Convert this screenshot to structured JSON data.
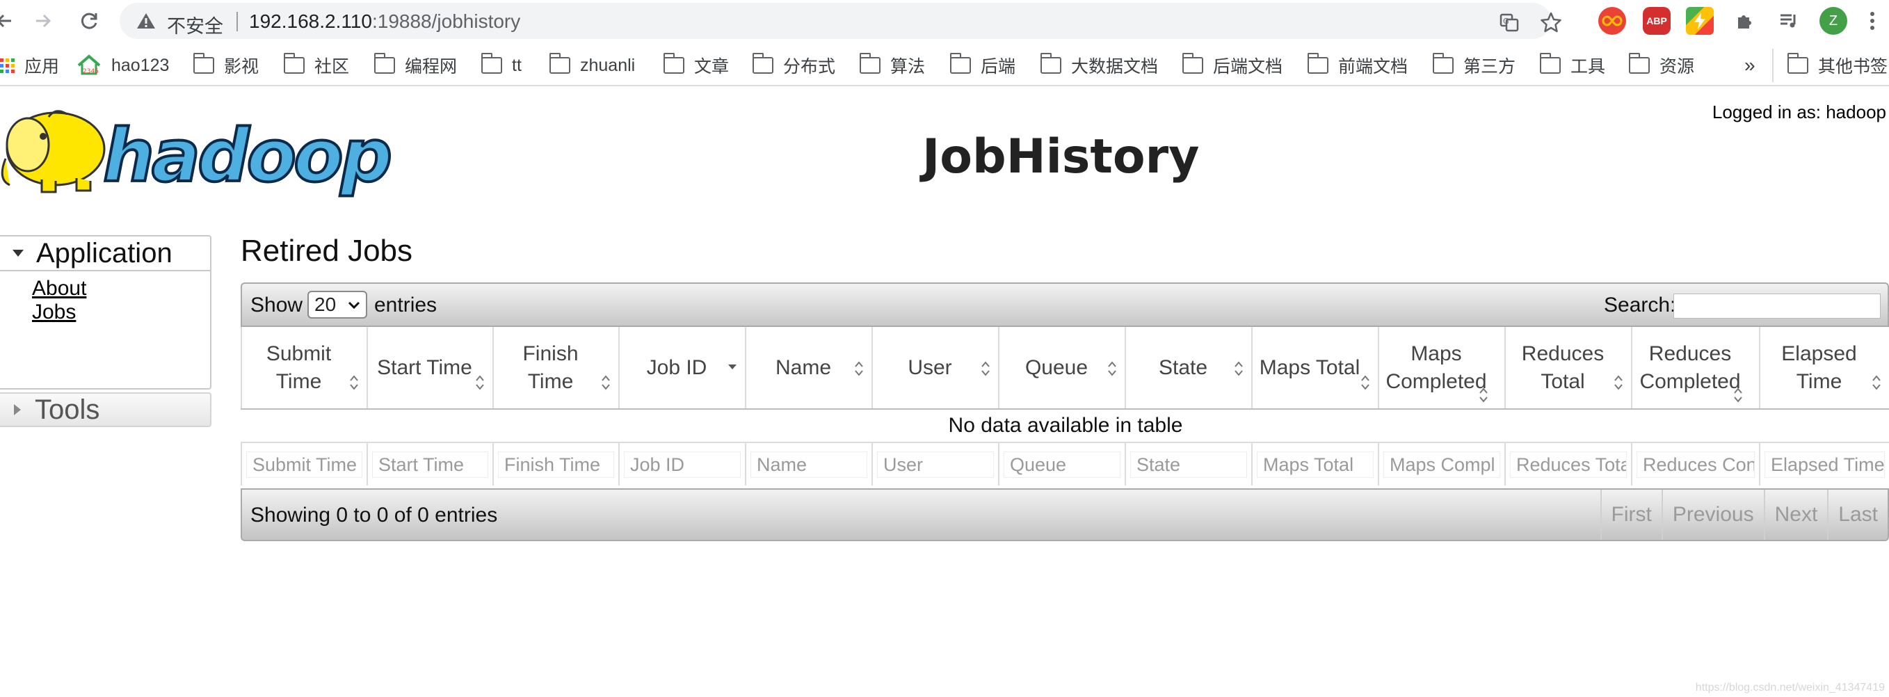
{
  "browser": {
    "security_label": "不安全",
    "url_host": "192.168.2.110",
    "url_rest": ":19888/jobhistory",
    "profile_initial": "Z",
    "ext_abp": "ABP"
  },
  "bookmarks": {
    "items": [
      "应用",
      "hao123",
      "影视",
      "社区",
      "编程网",
      "tt",
      "zhuanli",
      "文章",
      "分布式",
      "算法",
      "后端",
      "大数据文档",
      "后端文档",
      "前端文档",
      "第三方",
      "工具",
      "资源"
    ],
    "more": "»",
    "other": "其他书签"
  },
  "page": {
    "logged_in": "Logged in as: hadoop",
    "logo_text": "hadoop",
    "title": "JobHistory"
  },
  "nav": {
    "application": "Application",
    "links": [
      "About",
      "Jobs"
    ],
    "tools": "Tools"
  },
  "main": {
    "section_title": "Retired Jobs",
    "show_label": "Show",
    "page_length": "20",
    "entries_label": "entries",
    "search_label": "Search:",
    "columns": [
      "Submit Time",
      "Start Time",
      "Finish Time",
      "Job ID",
      "Name",
      "User",
      "Queue",
      "State",
      "Maps Total",
      "Maps Completed",
      "Reduces Total",
      "Reduces Completed",
      "Elapsed Time"
    ],
    "empty_message": "No data available in table",
    "filter_placeholders": [
      "Submit Time",
      "Start Time",
      "Finish Time",
      "Job ID",
      "Name",
      "User",
      "Queue",
      "State",
      "Maps Total",
      "Maps Compl",
      "Reduces Tota",
      "Reduces Con",
      "Elapsed Time"
    ],
    "info": "Showing 0 to 0 of 0 entries",
    "pager": [
      "First",
      "Previous",
      "Next",
      "Last"
    ]
  },
  "watermark": "https://blog.csdn.net/weixin_41347419"
}
